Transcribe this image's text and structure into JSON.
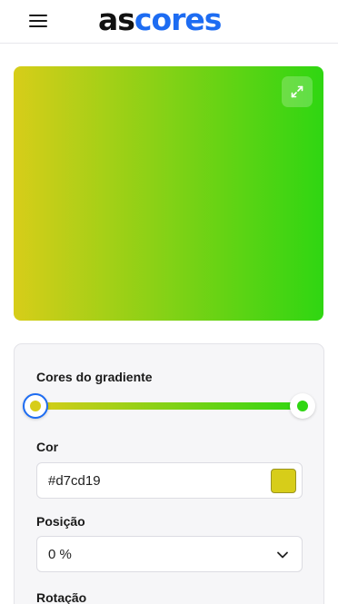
{
  "header": {
    "logo_part1": "as",
    "logo_part2": "cores"
  },
  "preview": {
    "gradient_start": "#d7cd19",
    "gradient_end": "#2fd612"
  },
  "panel": {
    "gradient_colors_label": "Cores do gradiente",
    "stops": [
      {
        "color": "#d7cd19",
        "position_percent": 0,
        "selected": true
      },
      {
        "color": "#2fd612",
        "position_percent": 100,
        "selected": false
      }
    ],
    "color_label": "Cor",
    "color_value": "#d7cd19",
    "position_label": "Posição",
    "position_value": "0 %",
    "rotation_label": "Rotação"
  },
  "icons": {
    "menu": "menu-icon",
    "expand": "expand-icon",
    "chevron": "chevron-down-icon"
  },
  "colors": {
    "brand_blue": "#1d6cf2"
  }
}
